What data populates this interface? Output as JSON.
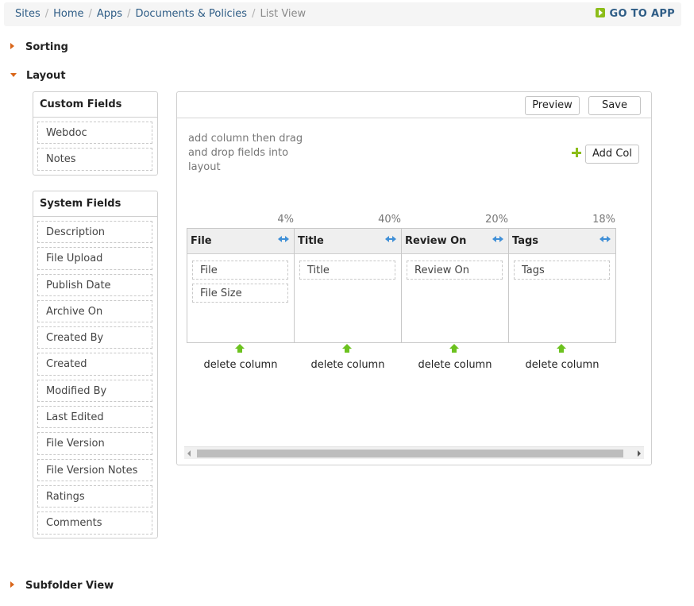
{
  "breadcrumb": {
    "items": [
      "Sites",
      "Home",
      "Apps",
      "Documents & Policies"
    ],
    "current": "List View",
    "separator": "/"
  },
  "go_to_app": {
    "label": "GO TO APP",
    "icon": "arrow-right-icon"
  },
  "sections": {
    "sorting": "Sorting",
    "layout": "Layout",
    "subfolder_view": "Subfolder View"
  },
  "custom_fields": {
    "title": "Custom Fields",
    "items": [
      "Webdoc",
      "Notes"
    ]
  },
  "system_fields": {
    "title": "System Fields",
    "items": [
      "Description",
      "File Upload",
      "Publish Date",
      "Archive On",
      "Created By",
      "Created",
      "Modified By",
      "Last Edited",
      "File Version",
      "File Version Notes",
      "Ratings",
      "Comments"
    ]
  },
  "editor": {
    "preview_label": "Preview",
    "save_label": "Save",
    "help_text": "add column then drag and drop fields into layout",
    "add_col_label": "Add Col",
    "delete_label": "delete column",
    "columns": [
      {
        "title": "File",
        "width": "4%",
        "fields": [
          "File",
          "File Size"
        ]
      },
      {
        "title": "Title",
        "width": "40%",
        "fields": [
          "Title"
        ]
      },
      {
        "title": "Review On",
        "width": "20%",
        "fields": [
          "Review On"
        ]
      },
      {
        "title": "Tags",
        "width": "18%",
        "fields": [
          "Tags"
        ]
      }
    ]
  },
  "colors": {
    "link": "#2f5d86",
    "accent_orange": "#d9661a",
    "accent_green": "#8cbd19",
    "resize_blue": "#3f8fd7"
  }
}
